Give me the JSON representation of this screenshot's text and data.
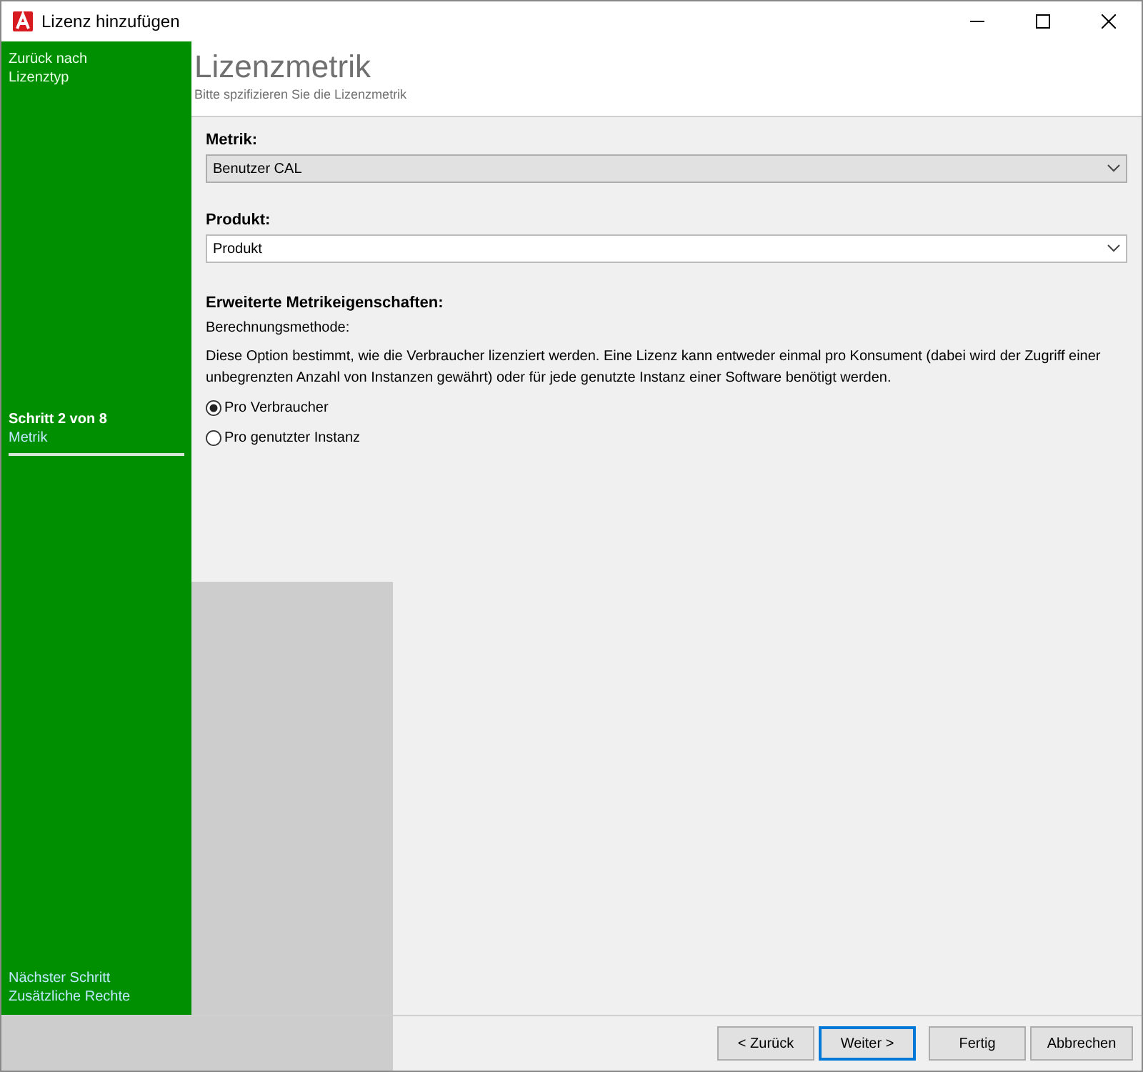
{
  "window": {
    "title": "Lizenz hinzufügen"
  },
  "sidebar": {
    "back_link": {
      "line_1": "Zurück nach",
      "line_2": "Lizenztyp"
    },
    "current_step": {
      "label": "Schritt 2 von 8",
      "name": "Metrik"
    },
    "next_step": {
      "label": "Nächster Schritt",
      "name": "Zusätzliche Rechte"
    }
  },
  "header": {
    "title": "Lizenzmetrik",
    "subtitle": "Bitte spzifizieren Sie die Lizenzmetrik"
  },
  "fields": [
    {
      "label": "Metrik:",
      "value": "Benutzer CAL",
      "disabled": true
    },
    {
      "label": "Produkt:",
      "value": "Produkt",
      "disabled": false
    }
  ],
  "advanced": {
    "heading": "Erweiterte Metrikeigenschaften:",
    "sublabel": "Berechnungsmethode:",
    "description": "Diese Option bestimmt, wie die Verbraucher lizenziert werden. Eine Lizenz kann entweder einmal pro Konsument (dabei wird der Zugriff einer unbegrenzten Anzahl von Instanzen gewährt) oder für jede genutzte Instanz einer Software benötigt werden.",
    "options": [
      {
        "label": "Pro Verbraucher",
        "selected": true
      },
      {
        "label": "Pro genutzter Instanz",
        "selected": false
      }
    ]
  },
  "buttons": [
    {
      "label": "< Zurück",
      "focused": false
    },
    {
      "label": "Weiter >",
      "focused": true
    },
    {
      "label": "Fertig",
      "focused": false
    },
    {
      "label": "Abbrechen",
      "focused": false
    }
  ]
}
